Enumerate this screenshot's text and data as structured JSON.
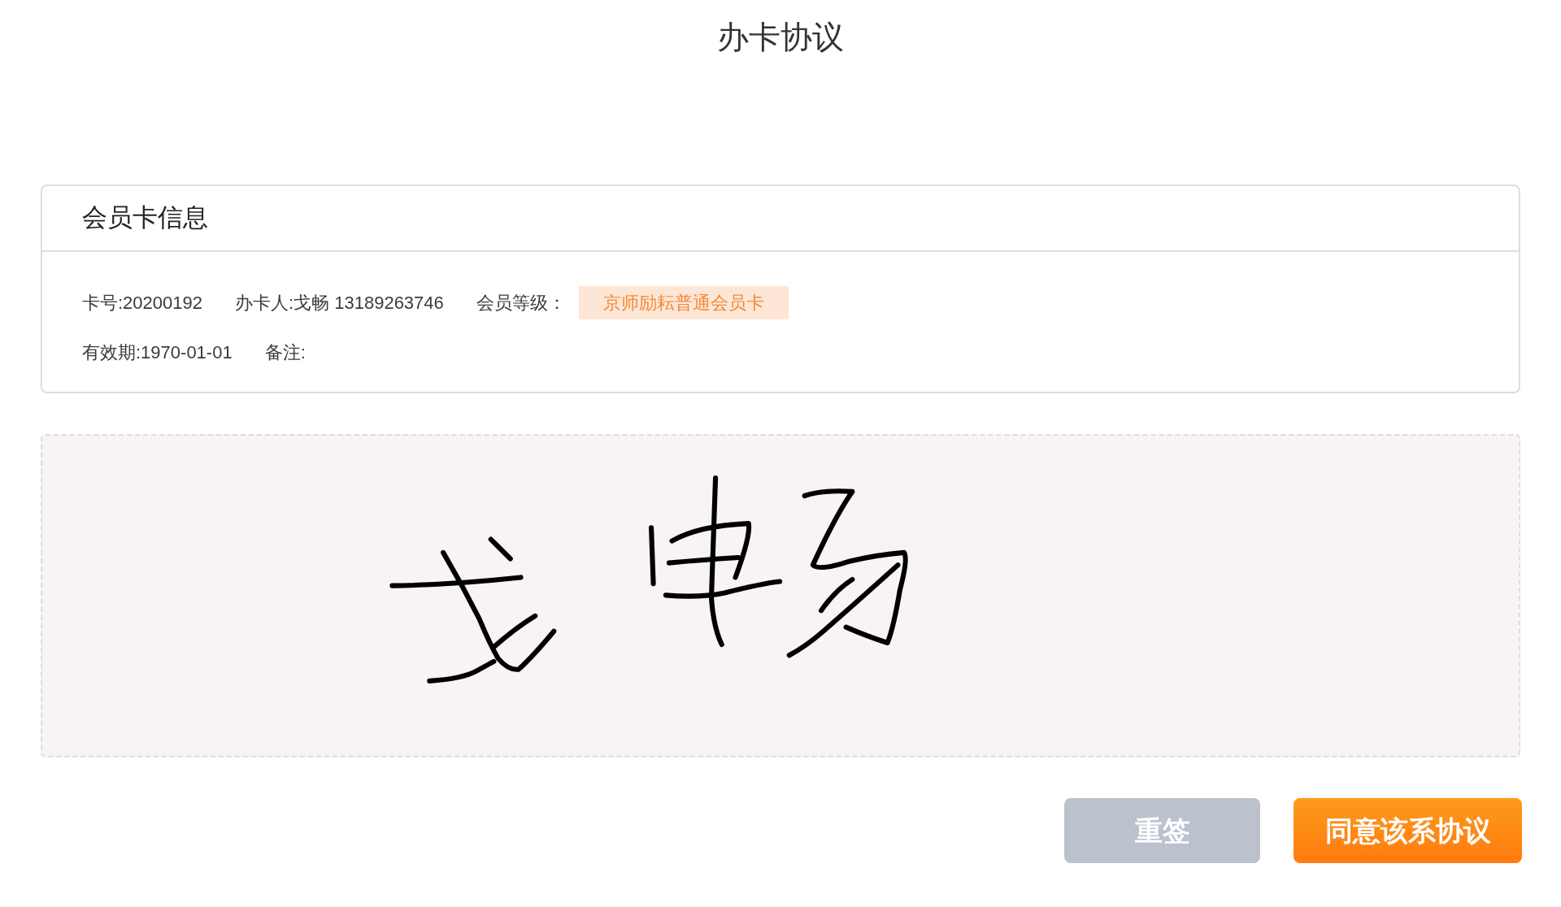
{
  "title": "办卡协议",
  "card_info": {
    "heading": "会员卡信息",
    "rows": [
      [
        {
          "kind": "text",
          "text": "卡号:20200192"
        },
        {
          "kind": "text",
          "text": "办卡人:戈畅 13189263746"
        },
        {
          "kind": "text",
          "text": "会员等级："
        },
        {
          "kind": "badge",
          "text": "京师励耘普通会员卡"
        }
      ],
      [
        {
          "kind": "text",
          "text": "有效期:1970-01-01"
        },
        {
          "kind": "text",
          "text": "备注:"
        }
      ]
    ]
  },
  "signature_pad": {
    "signed": true
  },
  "buttons": [
    {
      "kind": "secondary",
      "label": "重签"
    },
    {
      "kind": "primary",
      "label": "同意该系协议"
    }
  ]
}
